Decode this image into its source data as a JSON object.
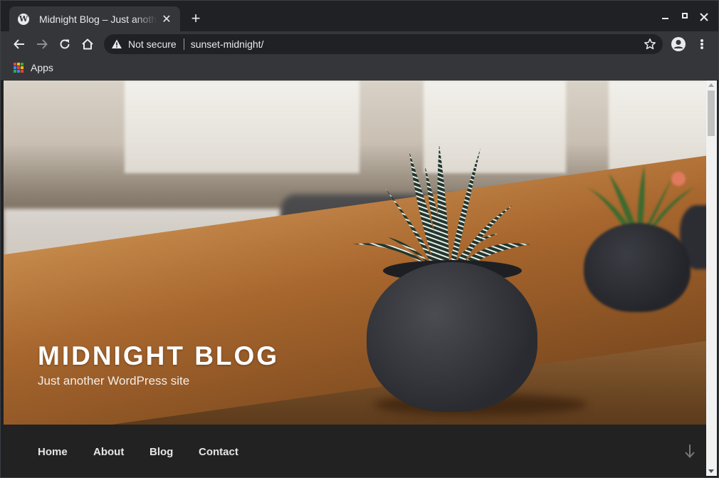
{
  "browser": {
    "tab": {
      "title": "Midnight Blog – Just another WordPress site",
      "favicon": "wordpress-icon",
      "favicon_glyph": "W",
      "close_glyph": "✕"
    },
    "new_tab_glyph": "+",
    "address": {
      "security_label": "Not secure",
      "url": "sunset-midnight/"
    },
    "bookmarks": {
      "apps_label": "Apps"
    }
  },
  "site": {
    "title": "MIDNIGHT BLOG",
    "description": "Just another WordPress site",
    "menu": [
      "Home",
      "About",
      "Blog",
      "Contact"
    ]
  },
  "colors": {
    "chrome_dark": "#202124",
    "chrome_toolbar": "#35363a",
    "site_nav_bg": "#222222",
    "apps_grid": [
      "#ea4335",
      "#fbbc05",
      "#34a853",
      "#4285f4",
      "#ea4335",
      "#fbbc05",
      "#34a853",
      "#4285f4",
      "#ea4335"
    ]
  }
}
